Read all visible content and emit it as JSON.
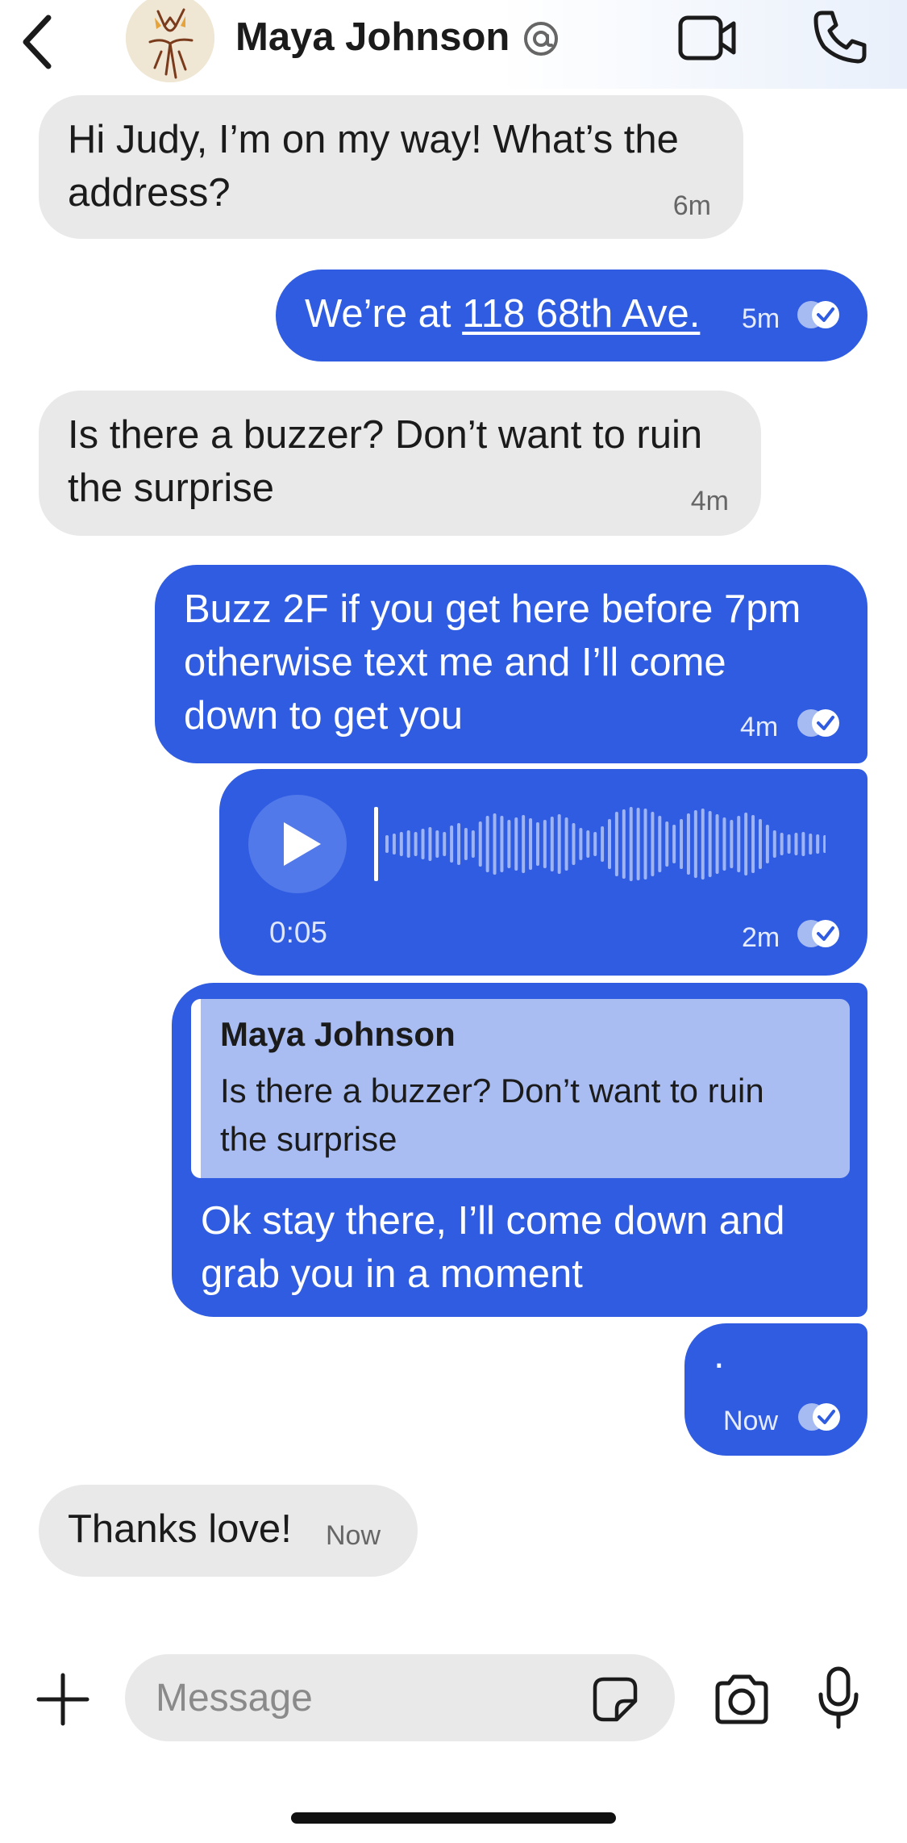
{
  "header": {
    "contact_name": "Maya Johnson",
    "icons": [
      "chevron-left-icon",
      "at-sign-icon",
      "video-camera-icon",
      "phone-icon"
    ]
  },
  "messages": [
    {
      "direction": "incoming",
      "text_lines": [
        "Hi Judy, I’m on my way! What’s the",
        "address?"
      ],
      "time": "6m"
    },
    {
      "direction": "outgoing",
      "text_prefix": "We’re at ",
      "link_text": "118 68th Ave.",
      "time": "5m",
      "status": "read"
    },
    {
      "direction": "incoming",
      "text_lines": [
        "Is there a buzzer? Don’t want to ruin",
        "the surprise"
      ],
      "time": "4m"
    },
    {
      "direction": "outgoing",
      "text_lines": [
        "Buzz 2F if you get here before 7pm",
        "otherwise text me and I’ll come",
        "down to get you"
      ],
      "time": "4m",
      "status": "read"
    },
    {
      "direction": "outgoing",
      "type": "voice",
      "duration": "0:05",
      "time": "2m",
      "status": "read"
    },
    {
      "direction": "outgoing",
      "quote_name": "Maya Johnson",
      "quote_lines": [
        "Is there a buzzer? Don’t want to ruin",
        "the surprise"
      ],
      "text_lines": [
        "Ok stay there, I’ll come down and",
        "grab you in a moment"
      ]
    },
    {
      "direction": "outgoing",
      "text": ".",
      "time": "Now",
      "status": "read"
    },
    {
      "direction": "incoming",
      "text": "Thanks love!",
      "time": "Now"
    }
  ],
  "composer": {
    "placeholder": "Message"
  },
  "colors": {
    "outgoing_bubble": "#2f5ce1",
    "incoming_bubble": "#e9e9e9",
    "quote_background": "#a9bdf3"
  }
}
